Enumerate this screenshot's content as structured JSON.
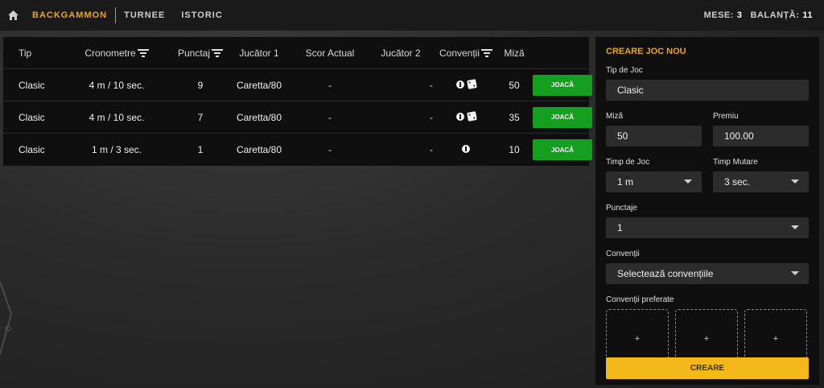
{
  "nav": {
    "items": [
      {
        "label": "BACKGAMMON",
        "active": true
      },
      {
        "label": "TURNEE",
        "active": false
      },
      {
        "label": "ISTORIC",
        "active": false
      }
    ],
    "mese_label": "MESE:",
    "mese_value": "3",
    "balanta_label": "BALANȚĂ:",
    "balanta_value": "11"
  },
  "table": {
    "headers": [
      "Tip",
      "Cronometre",
      "Punctaj",
      "Jucător 1",
      "Scor Actual",
      "Jucător 2",
      "Convenții",
      "Miză"
    ],
    "rows": [
      {
        "tip": "Clasic",
        "cronometre": "4 m / 10 sec.",
        "punctaj": "9",
        "jucator1": "Caretta/80",
        "scor": "-",
        "jucator2": "-",
        "miza": "50",
        "button": "JOACĂ",
        "icons": [
          "coin-icon",
          "dice-icon"
        ]
      },
      {
        "tip": "Clasic",
        "cronometre": "4 m / 10 sec.",
        "punctaj": "7",
        "jucator1": "Caretta/80",
        "scor": "-",
        "jucator2": "-",
        "miza": "35",
        "button": "JOACĂ",
        "icons": [
          "coin-icon",
          "dice-icon"
        ]
      },
      {
        "tip": "Clasic",
        "cronometre": "1 m / 3 sec.",
        "punctaj": "1",
        "jucator1": "Caretta/80",
        "scor": "-",
        "jucator2": "-",
        "miza": "10",
        "button": "JOACĂ",
        "icons": [
          "coin-icon"
        ]
      }
    ]
  },
  "create": {
    "title": "CREARE JOC NOU",
    "tip_label": "Tip de Joc",
    "tip_value": "Clasic",
    "miza_label": "Miză",
    "miza_value": "50",
    "premiu_label": "Premiu",
    "premiu_value": "100.00",
    "timp_joc_label": "Timp de Joc",
    "timp_joc_value": "1 m",
    "timp_mutare_label": "Timp Mutare",
    "timp_mutare_value": "3 sec.",
    "punctaje_label": "Punctaje",
    "punctaje_value": "1",
    "conventii_label": "Convenții",
    "conventii_value": "Selectează convențiile",
    "preferate_label": "Convenții preferate",
    "slot_symbol": "+",
    "button": "CREARE"
  },
  "colors": {
    "accent": "#e8a520",
    "play": "#14a01e",
    "create": "#f5b81a"
  }
}
